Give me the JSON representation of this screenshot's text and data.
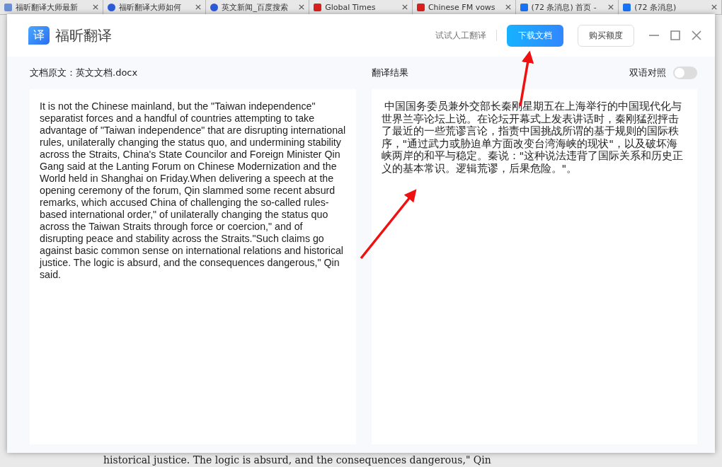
{
  "browser_tabs": [
    {
      "title": "福昕翻译大师最新",
      "kind": "doc"
    },
    {
      "title": "福昕翻译大师如何",
      "kind": "baidu"
    },
    {
      "title": "英文新闻_百度搜索",
      "kind": "baidu"
    },
    {
      "title": "Global Times",
      "kind": "g"
    },
    {
      "title": "Chinese FM vows",
      "kind": "g"
    },
    {
      "title": "(72 条消息) 首页 -",
      "kind": "zhi"
    },
    {
      "title": "(72 条消息)",
      "kind": "zhi"
    }
  ],
  "app": {
    "name": "福昕翻译",
    "logo_char": "译",
    "toolbar": {
      "link": "试试人工翻译",
      "primary_button": "下载文档",
      "secondary_button": "购买额度"
    },
    "source": {
      "label": "文档原文：英文文档.docx",
      "text": "It is not the Chinese mainland, but the \"Taiwan independence\" separatist forces and a handful of countries attempting to take advantage of \"Taiwan independence\" that are disrupting international rules, unilaterally changing the status quo, and undermining stability across the Straits, China's State Councilor and Foreign Minister Qin Gang said at the Lanting Forum on Chinese Modernization and the World held in Shanghai on Friday.When delivering a speech at the opening ceremony of the forum, Qin slammed some recent absurd remarks, which accused China of challenging the so-called rules-based international order,\" of unilaterally changing the status quo across the Taiwan Straits through force or coercion,\" and of disrupting peace and stability across the Straits.\"Such claims go against basic common sense on international relations and historical justice. The logic is absurd, and the consequences dangerous,\" Qin said."
    },
    "result": {
      "label": "翻译结果",
      "toggle_label": "双语对照",
      "bilingual_on": false,
      "text": " 中国国务委员兼外交部长秦刚星期五在上海举行的中国现代化与世界兰亭论坛上说。在论坛开幕式上发表讲话时，秦刚猛烈抨击了最近的一些荒谬言论，指责中国挑战所谓的基于规则的国际秩序，\"通过武力或胁迫单方面改变台湾海峡的现状\"，以及破坏海峡两岸的和平与稳定。秦说：\"这种说法违背了国际关系和历史正义的基本常识。逻辑荒谬，后果危险。\"。"
    }
  },
  "background_text": "historical justice. The logic is absurd, and the consequences dangerous,\" Qin"
}
